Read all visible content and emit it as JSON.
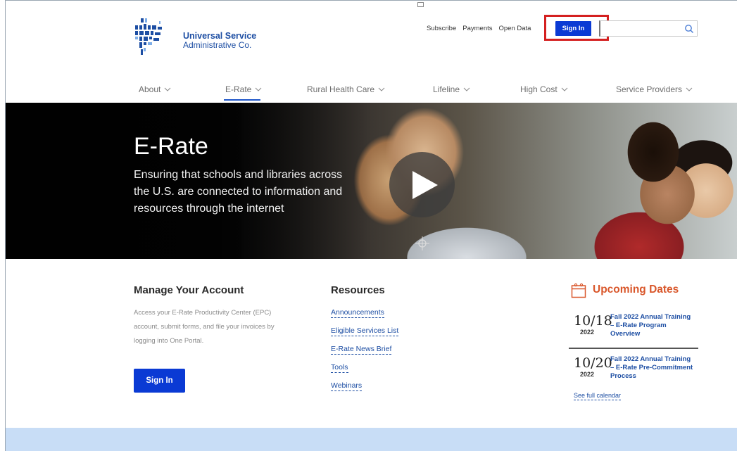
{
  "header": {
    "logo_line1": "Universal Service",
    "logo_line2": "Administrative Co.",
    "utility_links": [
      "Subscribe",
      "Payments",
      "Open Data"
    ],
    "sign_in_label": "Sign In",
    "search_value": "",
    "search_icon": "search-icon"
  },
  "nav": {
    "items": [
      {
        "label": "About"
      },
      {
        "label": "E-Rate",
        "active": true
      },
      {
        "label": "Rural Health Care"
      },
      {
        "label": "Lifeline"
      },
      {
        "label": "High Cost"
      },
      {
        "label": "Service Providers"
      }
    ]
  },
  "hero": {
    "title": "E-Rate",
    "description": "Ensuring that schools and libraries across the U.S. are connected to information and resources through the internet",
    "play_icon": "play-icon"
  },
  "manage": {
    "title": "Manage Your Account",
    "description": "Access your E-Rate Productivity Center (EPC) account, submit forms, and file your invoices by logging into One Portal.",
    "button_label": "Sign In"
  },
  "resources": {
    "title": "Resources",
    "links": [
      "Announcements",
      "Eligible Services List",
      "E-Rate News Brief",
      "Tools",
      "Webinars"
    ]
  },
  "upcoming": {
    "title": "Upcoming Dates",
    "events": [
      {
        "date": "10/18",
        "year": "2022",
        "title": "Fall 2022 Annual Training – E-Rate Program Overview"
      },
      {
        "date": "10/20",
        "year": "2022",
        "title": "Fall 2022 Annual Training – E-Rate Pre-Commitment Process"
      }
    ],
    "see_calendar": "See full calendar"
  },
  "colors": {
    "brand_blue": "#0a3ad4",
    "link_blue": "#1d4ea3",
    "accent_orange": "#d9572b",
    "highlight_red": "#d42020",
    "footer_band": "#c8ddf6"
  }
}
